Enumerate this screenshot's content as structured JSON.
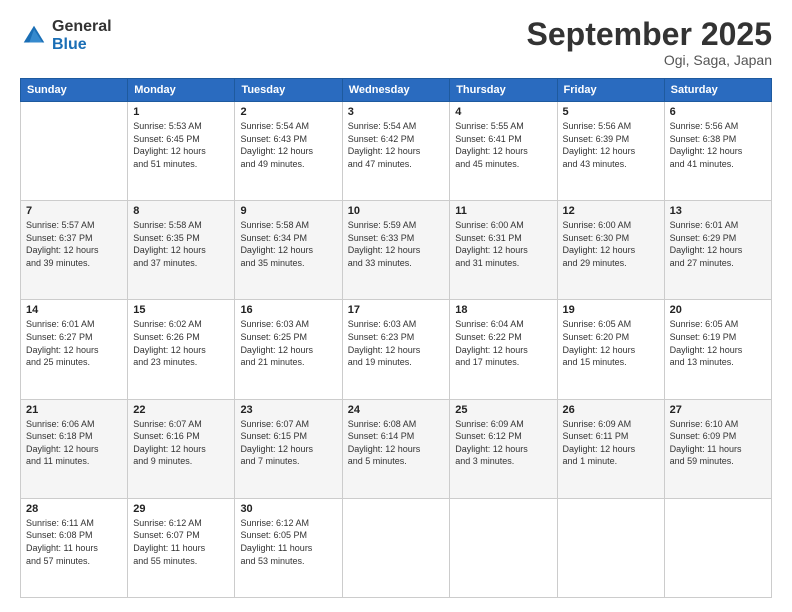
{
  "header": {
    "logo_general": "General",
    "logo_blue": "Blue",
    "title": "September 2025",
    "location": "Ogi, Saga, Japan"
  },
  "days_of_week": [
    "Sunday",
    "Monday",
    "Tuesday",
    "Wednesday",
    "Thursday",
    "Friday",
    "Saturday"
  ],
  "weeks": [
    [
      {
        "day": "",
        "info": ""
      },
      {
        "day": "1",
        "info": "Sunrise: 5:53 AM\nSunset: 6:45 PM\nDaylight: 12 hours\nand 51 minutes."
      },
      {
        "day": "2",
        "info": "Sunrise: 5:54 AM\nSunset: 6:43 PM\nDaylight: 12 hours\nand 49 minutes."
      },
      {
        "day": "3",
        "info": "Sunrise: 5:54 AM\nSunset: 6:42 PM\nDaylight: 12 hours\nand 47 minutes."
      },
      {
        "day": "4",
        "info": "Sunrise: 5:55 AM\nSunset: 6:41 PM\nDaylight: 12 hours\nand 45 minutes."
      },
      {
        "day": "5",
        "info": "Sunrise: 5:56 AM\nSunset: 6:39 PM\nDaylight: 12 hours\nand 43 minutes."
      },
      {
        "day": "6",
        "info": "Sunrise: 5:56 AM\nSunset: 6:38 PM\nDaylight: 12 hours\nand 41 minutes."
      }
    ],
    [
      {
        "day": "7",
        "info": "Sunrise: 5:57 AM\nSunset: 6:37 PM\nDaylight: 12 hours\nand 39 minutes."
      },
      {
        "day": "8",
        "info": "Sunrise: 5:58 AM\nSunset: 6:35 PM\nDaylight: 12 hours\nand 37 minutes."
      },
      {
        "day": "9",
        "info": "Sunrise: 5:58 AM\nSunset: 6:34 PM\nDaylight: 12 hours\nand 35 minutes."
      },
      {
        "day": "10",
        "info": "Sunrise: 5:59 AM\nSunset: 6:33 PM\nDaylight: 12 hours\nand 33 minutes."
      },
      {
        "day": "11",
        "info": "Sunrise: 6:00 AM\nSunset: 6:31 PM\nDaylight: 12 hours\nand 31 minutes."
      },
      {
        "day": "12",
        "info": "Sunrise: 6:00 AM\nSunset: 6:30 PM\nDaylight: 12 hours\nand 29 minutes."
      },
      {
        "day": "13",
        "info": "Sunrise: 6:01 AM\nSunset: 6:29 PM\nDaylight: 12 hours\nand 27 minutes."
      }
    ],
    [
      {
        "day": "14",
        "info": "Sunrise: 6:01 AM\nSunset: 6:27 PM\nDaylight: 12 hours\nand 25 minutes."
      },
      {
        "day": "15",
        "info": "Sunrise: 6:02 AM\nSunset: 6:26 PM\nDaylight: 12 hours\nand 23 minutes."
      },
      {
        "day": "16",
        "info": "Sunrise: 6:03 AM\nSunset: 6:25 PM\nDaylight: 12 hours\nand 21 minutes."
      },
      {
        "day": "17",
        "info": "Sunrise: 6:03 AM\nSunset: 6:23 PM\nDaylight: 12 hours\nand 19 minutes."
      },
      {
        "day": "18",
        "info": "Sunrise: 6:04 AM\nSunset: 6:22 PM\nDaylight: 12 hours\nand 17 minutes."
      },
      {
        "day": "19",
        "info": "Sunrise: 6:05 AM\nSunset: 6:20 PM\nDaylight: 12 hours\nand 15 minutes."
      },
      {
        "day": "20",
        "info": "Sunrise: 6:05 AM\nSunset: 6:19 PM\nDaylight: 12 hours\nand 13 minutes."
      }
    ],
    [
      {
        "day": "21",
        "info": "Sunrise: 6:06 AM\nSunset: 6:18 PM\nDaylight: 12 hours\nand 11 minutes."
      },
      {
        "day": "22",
        "info": "Sunrise: 6:07 AM\nSunset: 6:16 PM\nDaylight: 12 hours\nand 9 minutes."
      },
      {
        "day": "23",
        "info": "Sunrise: 6:07 AM\nSunset: 6:15 PM\nDaylight: 12 hours\nand 7 minutes."
      },
      {
        "day": "24",
        "info": "Sunrise: 6:08 AM\nSunset: 6:14 PM\nDaylight: 12 hours\nand 5 minutes."
      },
      {
        "day": "25",
        "info": "Sunrise: 6:09 AM\nSunset: 6:12 PM\nDaylight: 12 hours\nand 3 minutes."
      },
      {
        "day": "26",
        "info": "Sunrise: 6:09 AM\nSunset: 6:11 PM\nDaylight: 12 hours\nand 1 minute."
      },
      {
        "day": "27",
        "info": "Sunrise: 6:10 AM\nSunset: 6:09 PM\nDaylight: 11 hours\nand 59 minutes."
      }
    ],
    [
      {
        "day": "28",
        "info": "Sunrise: 6:11 AM\nSunset: 6:08 PM\nDaylight: 11 hours\nand 57 minutes."
      },
      {
        "day": "29",
        "info": "Sunrise: 6:12 AM\nSunset: 6:07 PM\nDaylight: 11 hours\nand 55 minutes."
      },
      {
        "day": "30",
        "info": "Sunrise: 6:12 AM\nSunset: 6:05 PM\nDaylight: 11 hours\nand 53 minutes."
      },
      {
        "day": "",
        "info": ""
      },
      {
        "day": "",
        "info": ""
      },
      {
        "day": "",
        "info": ""
      },
      {
        "day": "",
        "info": ""
      }
    ]
  ]
}
